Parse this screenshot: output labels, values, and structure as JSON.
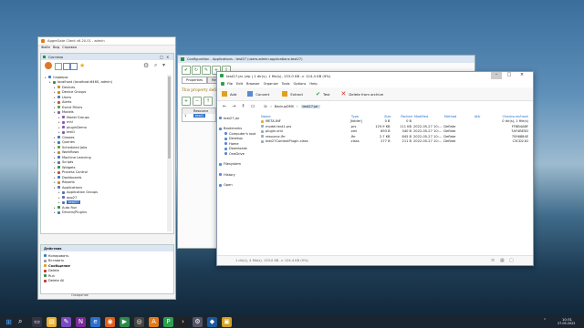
{
  "client": {
    "title": "AggreGate Client v6.20.01 - admin",
    "menu": [
      "Файл",
      "Вид",
      "Справка"
    ],
    "system_title": "Система",
    "tree": [
      {
        "label": "Серверы",
        "indent": 0,
        "color": "#3a7ab8"
      },
      {
        "label": "localhost (localhost:6460, admin)",
        "indent": 1,
        "color": "#2f8f3f"
      },
      {
        "label": "Devices",
        "indent": 2,
        "color": "#c98a1a"
      },
      {
        "label": "Device Groups",
        "indent": 2,
        "color": "#c98a1a"
      },
      {
        "label": "Users",
        "indent": 2,
        "color": "#5a6fb0"
      },
      {
        "label": "Alerts",
        "indent": 2,
        "color": "#d04a3a"
      },
      {
        "label": "Event Filters",
        "indent": 2,
        "color": "#5a9a4a"
      },
      {
        "label": "Models",
        "indent": 2,
        "color": "#8a5ab0"
      },
      {
        "label": "Model Groups",
        "indent": 3,
        "color": "#8a5ab0"
      },
      {
        "label": "mhl",
        "indent": 3,
        "color": "#8a5ab0"
      },
      {
        "label": "pluginDemo",
        "indent": 3,
        "color": "#8a5ab0"
      },
      {
        "label": "test1",
        "indent": 3,
        "color": "#8a5ab0"
      },
      {
        "label": "Classes",
        "indent": 2,
        "color": "#3a7ab8"
      },
      {
        "label": "Queries",
        "indent": 2,
        "color": "#3a7ab8"
      },
      {
        "label": "Scheduled Jobs",
        "indent": 2,
        "color": "#5a9a4a"
      },
      {
        "label": "Workflows",
        "indent": 2,
        "color": "#c98a1a"
      },
      {
        "label": "Machine Learning",
        "indent": 2,
        "color": "#3a7ab8"
      },
      {
        "label": "Scripts",
        "indent": 2,
        "color": "#5a6fb0"
      },
      {
        "label": "Widgets",
        "indent": 2,
        "color": "#2f8f3f"
      },
      {
        "label": "Process Control",
        "indent": 2,
        "color": "#d04a3a"
      },
      {
        "label": "Dashboards",
        "indent": 2,
        "color": "#3a7ab8"
      },
      {
        "label": "Reports",
        "indent": 2,
        "color": "#c98a1a"
      },
      {
        "label": "Applications",
        "indent": 2,
        "color": "#5a6fb0"
      },
      {
        "label": "Application Groups",
        "indent": 3,
        "color": "#5a6fb0"
      },
      {
        "label": "app27",
        "indent": 3,
        "color": "#5a6fb0"
      },
      {
        "label": "test27",
        "indent": 3,
        "color": "#5a6fb0",
        "selected": true
      },
      {
        "label": "Auto Run",
        "indent": 2,
        "color": "#2f8f3f"
      },
      {
        "label": "Drivers/Plugins",
        "indent": 2,
        "color": "#3a7ab8"
      }
    ],
    "actions_title": "Действия",
    "actions": [
      "Копировать",
      "Вставить",
      "Сообщение",
      "Delete",
      "Run",
      "Delete All"
    ],
    "status": "Ожидание"
  },
  "config": {
    "title": "Configuration - Applications - test27 (users.admin.applications.test27)",
    "tabs": [
      "Properties",
      "Relations"
    ],
    "notice": "This property defines",
    "table_header": [
      "",
      "Resource"
    ],
    "table_row": [
      "1",
      "test1"
    ]
  },
  "archive": {
    "title": "test27.jar (zip | 1 dir(s), 1 file(s), 133.0 KB -> 124.4 KB (9%)",
    "menu": [
      "File",
      "Edit",
      "Browser",
      "Organize",
      "Tools",
      "Options",
      "Help"
    ],
    "toolbar": [
      "Add",
      "Convert",
      "Extract",
      "Test",
      "Delete from archive"
    ],
    "breadcrumb": [
      "D:",
      "BackupDMS",
      "test27.jar"
    ],
    "sidebar": [
      {
        "label": "test27.jar",
        "group": "top"
      },
      {
        "label": "Bookmarks",
        "group": "bookmarks"
      },
      {
        "label": "Computer's root",
        "group": "bookmarks"
      },
      {
        "label": "Desktop",
        "group": "bookmarks"
      },
      {
        "label": "Home",
        "group": "bookmarks"
      },
      {
        "label": "Downloads",
        "group": "bookmarks"
      },
      {
        "label": "OneDrive",
        "group": "bookmarks"
      },
      {
        "label": "Filesystem",
        "group": "fs"
      },
      {
        "label": "History",
        "group": "hist"
      },
      {
        "label": "Open",
        "group": "open"
      }
    ],
    "columns": [
      "Name",
      "Type",
      "Size",
      "Packed",
      "Modified",
      "Method",
      "Attr",
      "Checksum/hash"
    ],
    "rows": [
      [
        "META-INF",
        "[folder]",
        "0 B",
        "0 B",
        "",
        "",
        "",
        "0 dir(s), 1 file(s)"
      ],
      [
        "model.test1.prs",
        ".prs",
        "129.9 KB",
        "111 KB",
        "2022-05-27 10:...",
        "Deflate",
        "",
        "FF8B4ABF"
      ],
      [
        "plugin.xml",
        ".xml",
        "693 B",
        "340 B",
        "2022-05-27 10:...",
        "Deflate",
        "",
        "7AF4BE5D"
      ],
      [
        "resource.lfrr",
        ".lfrr",
        "2.7 KB",
        "845 B",
        "2022-05-27 10:...",
        "Deflate",
        "",
        "7096884E"
      ],
      [
        "test27ContextPlugin.class",
        ".class",
        "277 B",
        "211 B",
        "2022-05-27 10:...",
        "Deflate",
        "",
        "C3CD21D"
      ]
    ],
    "status": "1 dir(s), 4 file(s), 133.0 KB -> 124.4 KB (9%)"
  },
  "taskbar": {
    "time": "10:31",
    "date": "27.05.2022"
  },
  "colors": {
    "accent": "#1e6fcf",
    "selection": "#cce4f7",
    "tree_selection": "#3874c8"
  }
}
